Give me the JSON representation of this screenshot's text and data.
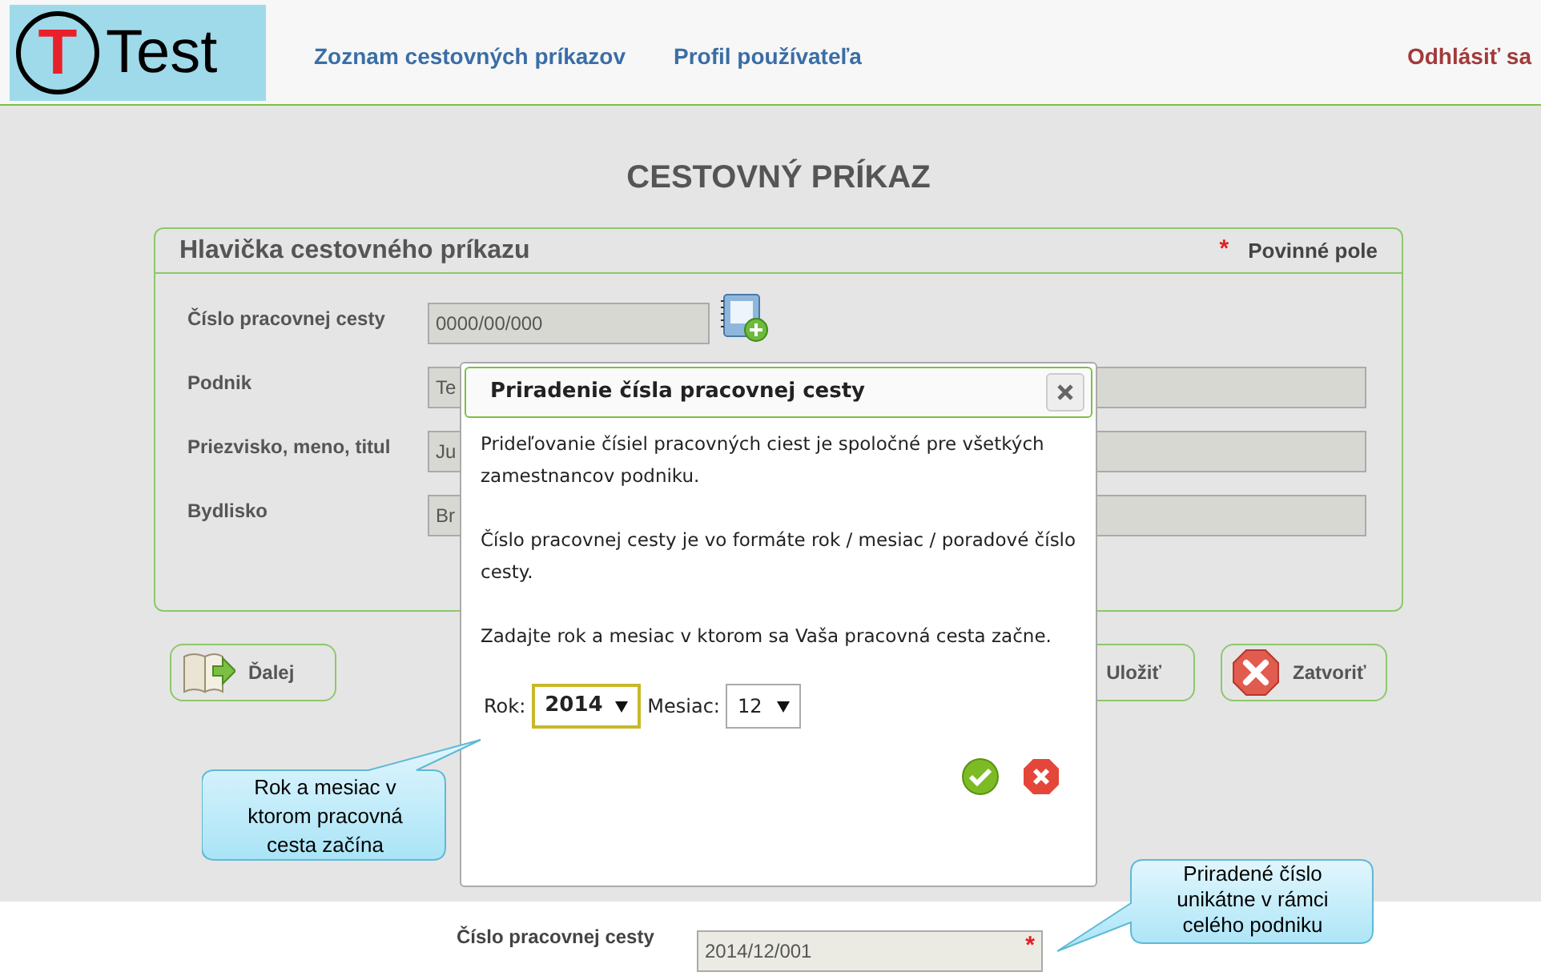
{
  "logo": {
    "letter": "T",
    "text": "Test"
  },
  "nav": [
    {
      "label": "Zoznam cestovných príkazov"
    },
    {
      "label": "Profil používateľa"
    }
  ],
  "logout": "Odhlásiť sa",
  "page_title": "CESTOVNÝ PRÍKAZ",
  "panel": {
    "title": "Hlavička cestovného príkazu",
    "required_mark": "*",
    "required_note": "Povinné pole",
    "fields": [
      {
        "label": "Číslo pracovnej cesty",
        "value": "0000/00/000",
        "kind": "number"
      },
      {
        "label": "Podnik",
        "value": "Te",
        "kind": "text"
      },
      {
        "label": "Priezvisko, meno, titul",
        "value": "Ju",
        "kind": "text"
      },
      {
        "label": "Bydlisko",
        "value": "Br",
        "kind": "text"
      }
    ]
  },
  "buttons": [
    {
      "label": "Ďalej",
      "kind": "next"
    },
    {
      "label": "Uložiť",
      "kind": "save"
    },
    {
      "label": "Zatvoriť",
      "kind": "close"
    }
  ],
  "dialog": {
    "title": "Priradenie čísla pracovnej cesty",
    "paragraphs": [
      "Prideľovanie čísiel pracovných ciest je spoločné pre všetkých zamestnancov podniku.",
      "Číslo pracovnej cesty je vo formáte rok / mesiac / poradové číslo cesty.",
      "Zadajte rok a mesiac v ktorom sa Vaša pracovná cesta začne."
    ],
    "year": {
      "label": "Rok:",
      "value": "2014",
      "focused": true
    },
    "month": {
      "label": "Mesiac:",
      "value": "12",
      "focused": false
    }
  },
  "callouts": [
    {
      "text": "Rok a mesiac v ktorom pracovná cesta začína"
    },
    {
      "text": "Priradené číslo unikátne v rámci celého podniku"
    }
  ],
  "result": {
    "label": "Číslo pracovnej cesty",
    "value": "2014/12/001",
    "required_mark": "*"
  }
}
